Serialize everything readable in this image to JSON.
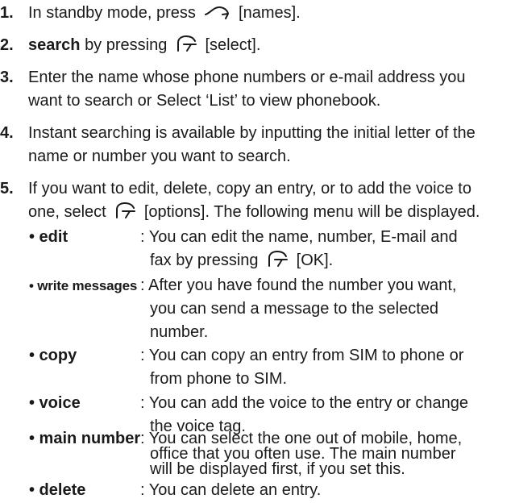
{
  "steps": [
    {
      "num": "1.",
      "pre": "In standby mode, press",
      "key": "[names]."
    },
    {
      "num": "2.",
      "bold": "search",
      "mid": "by pressing",
      "key": "[select]."
    },
    {
      "num": "3.",
      "lines": [
        "Enter the name whose phone numbers or e-mail address you",
        "want to search or Select ‘List’ to view phonebook."
      ]
    },
    {
      "num": "4.",
      "lines": [
        "Instant searching is available by inputting the initial letter of the",
        "name or number you want to search."
      ]
    },
    {
      "num": "5.",
      "line1": "If you want to edit, delete, copy an entry, or to add the voice to",
      "line2_pre": "one, select",
      "line2_post": "[options]. The following menu will be displayed."
    }
  ],
  "options": [
    {
      "label": "• edit",
      "lines": [
        ": You can edit the name, number, E-mail and"
      ],
      "last_pre": "fax by pressing",
      "last_post": "[OK]."
    },
    {
      "label": "• write messages",
      "lines": [
        ": After you have found the number you want,",
        "you can send a message to the selected",
        "number."
      ]
    },
    {
      "label": "• copy",
      "lines": [
        ": You can copy an entry from SIM to phone or",
        "from phone to SIM."
      ]
    },
    {
      "label": "• voice",
      "lines": [
        ": You can add the voice to the entry or change",
        "the voice tag."
      ]
    },
    {
      "label": "• main number",
      "lines": [
        ": You can select the one out of mobile, home,",
        "office that you often use. The main number",
        "will be displayed first, if you set this."
      ]
    },
    {
      "label": "• delete",
      "lines": [
        ": You can delete an entry."
      ]
    }
  ],
  "icons": {
    "names_key": "right-softkey-icon",
    "select_key": "left-softkey-icon"
  }
}
